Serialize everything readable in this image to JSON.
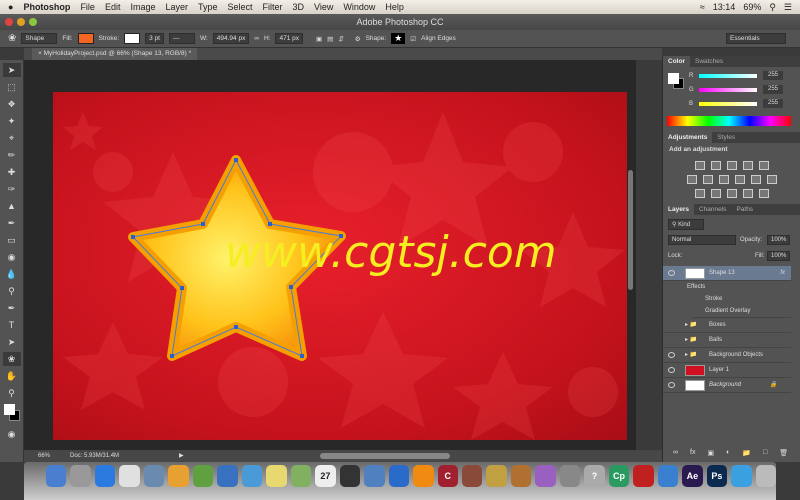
{
  "menubar": {
    "apple": "",
    "app": "Photoshop",
    "items": [
      "File",
      "Edit",
      "Image",
      "Layer",
      "Type",
      "Select",
      "Filter",
      "3D",
      "View",
      "Window",
      "Help"
    ],
    "clock": "13:14",
    "battery": "69%"
  },
  "window": {
    "title": "Adobe Photoshop CC"
  },
  "options": {
    "mode": "Shape",
    "fill_label": "Fill:",
    "fill_color": "#f26522",
    "stroke_label": "Stroke:",
    "stroke_width": "3 pt",
    "w_label": "W:",
    "w_value": "494.94 px",
    "h_label": "H:",
    "h_value": "471 px",
    "shape_label": "Shape:",
    "align_edges": "Align Edges",
    "workspace": "Essentials"
  },
  "document": {
    "tab": "MyHolidayProject.psd @ 66% (Shape 13, RGB/8) *",
    "watermark": "www.cgtsj.com"
  },
  "status": {
    "zoom": "66%",
    "doc": "Doc: 5.93M/31.4M"
  },
  "color_panel": {
    "tabs": [
      "Color",
      "Swatches"
    ],
    "channels": [
      {
        "label": "R",
        "value": "255"
      },
      {
        "label": "G",
        "value": "255"
      },
      {
        "label": "B",
        "value": "255"
      }
    ]
  },
  "adjustments_panel": {
    "tabs": [
      "Adjustments",
      "Styles"
    ],
    "heading": "Add an adjustment"
  },
  "layers_panel": {
    "tabs": [
      "Layers",
      "Channels",
      "Paths"
    ],
    "filter": "Kind",
    "blend": "Normal",
    "opacity_label": "Opacity:",
    "opacity": "100%",
    "lock_label": "Lock:",
    "fill_label": "Fill:",
    "fill": "100%",
    "layers": [
      {
        "name": "Shape 13",
        "fx": "fx"
      },
      {
        "name": "Effects"
      },
      {
        "name": "Stroke"
      },
      {
        "name": "Gradient Overlay"
      },
      {
        "name": "Boxes"
      },
      {
        "name": "Balls"
      },
      {
        "name": "Background Objects"
      },
      {
        "name": "Layer 1"
      },
      {
        "name": "Background"
      }
    ]
  },
  "dock": {
    "apps": [
      "Finder",
      "Launchpad",
      "App Store",
      "Chrome",
      "Preview",
      "Pages",
      "Numbers",
      "Keynote",
      "Xcode",
      "Notes",
      "Maps",
      "Calendar",
      "Unity",
      "Remote",
      "iTunes",
      "iBooks",
      "C",
      "Photo",
      "Fruit",
      "GarageBand",
      "Drops",
      "Settings",
      "?",
      "Cp",
      "Bar",
      "Tools",
      "Ae",
      "Ps",
      "QuickTime",
      "Trash"
    ],
    "calendar_day": "27"
  }
}
